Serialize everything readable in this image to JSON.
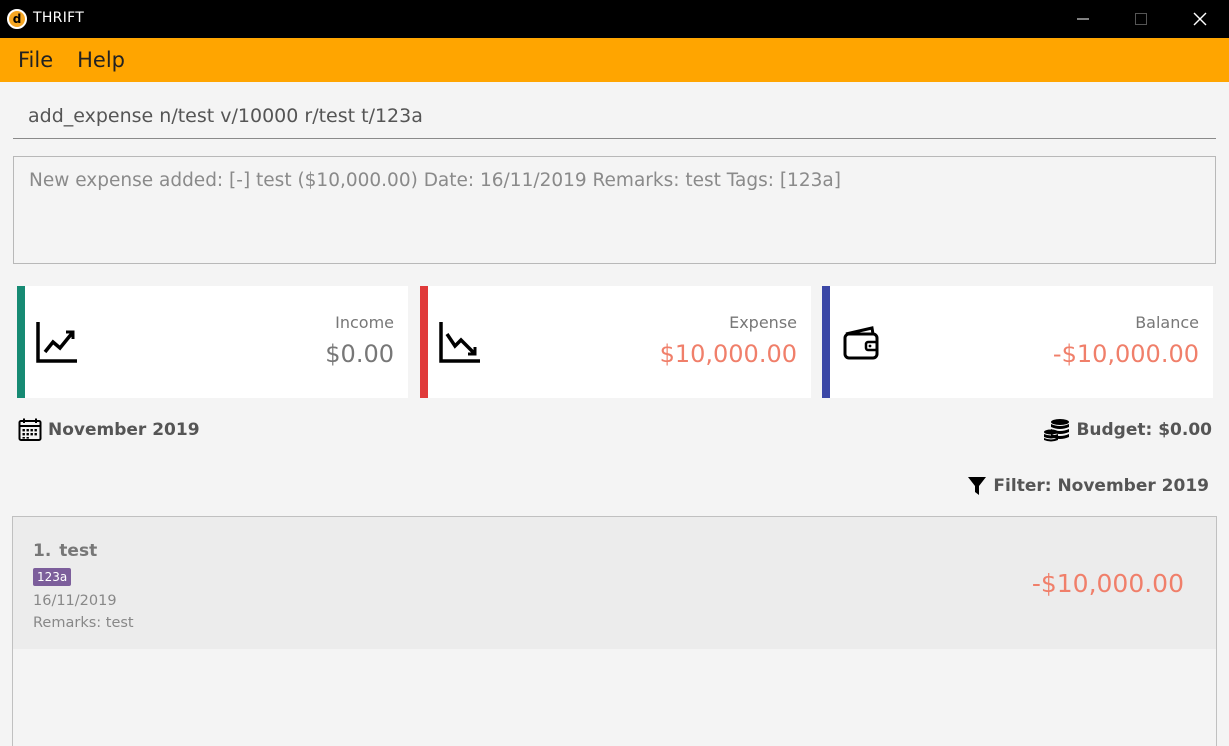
{
  "window": {
    "title": "THRIFT",
    "logo_letter": "d"
  },
  "menu": {
    "items": [
      "File",
      "Help"
    ]
  },
  "command": {
    "value": "add_expense n/test v/10000 r/test t/123a"
  },
  "result": {
    "text": "New expense added: [-] test ($10,000.00) Date: 16/11/2019 Remarks: test Tags: [123a]"
  },
  "summary": {
    "income": {
      "label": "Income",
      "value": "$0.00",
      "color": "#777777",
      "stripe": "#168a73",
      "icon": "trend-up-icon"
    },
    "expense": {
      "label": "Expense",
      "value": "$10,000.00",
      "color": "#f07f6a",
      "stripe": "#e03a3a",
      "icon": "trend-down-icon"
    },
    "balance": {
      "label": "Balance",
      "value": "-$10,000.00",
      "color": "#f07f6a",
      "stripe": "#3b47a6",
      "icon": "wallet-icon"
    }
  },
  "period": {
    "month": "November 2019",
    "budget": "Budget: $0.00",
    "filter": "Filter: November 2019"
  },
  "transactions": [
    {
      "index": "1.",
      "name": "test",
      "tag": "123a",
      "date": "16/11/2019",
      "remarks": "Remarks: test",
      "amount": "-$10,000.00"
    }
  ],
  "colors": {
    "menubar": "#ffa500",
    "titlebar": "#000000",
    "tag": "#7c5e9b"
  }
}
